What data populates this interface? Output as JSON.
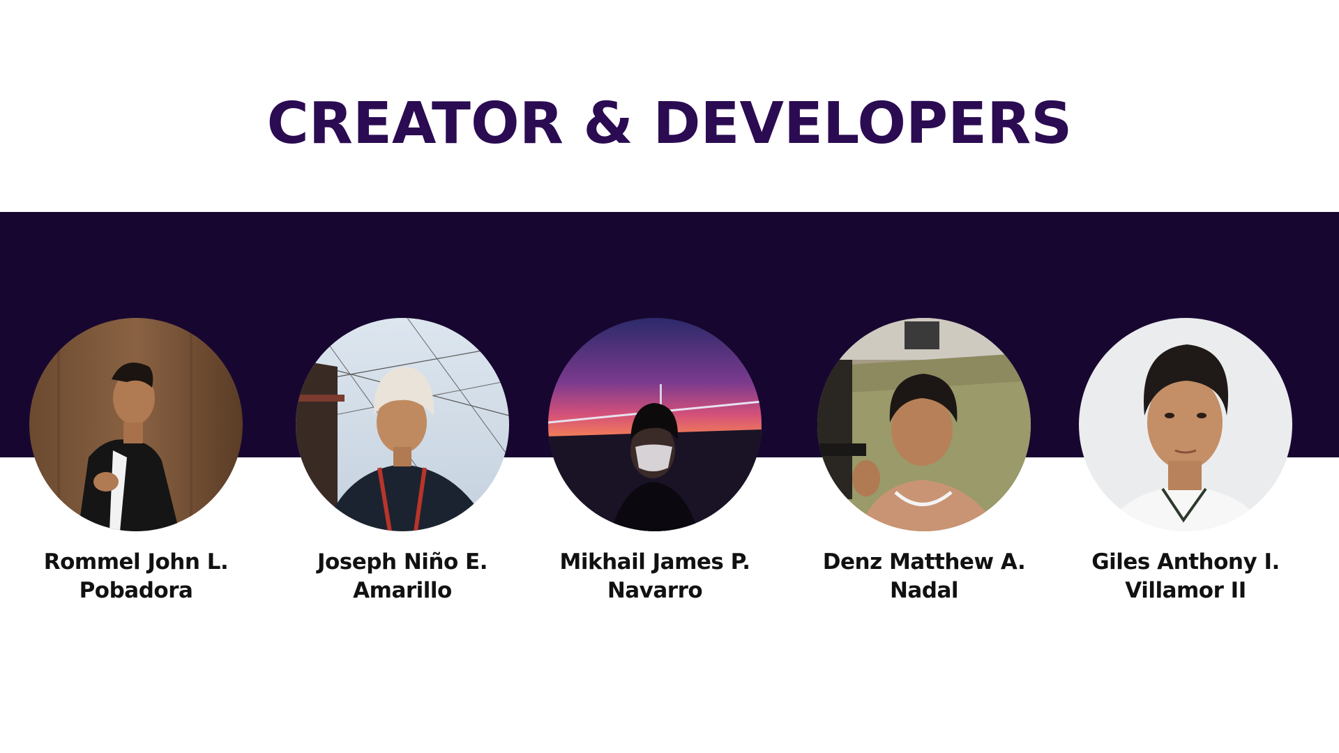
{
  "title": "CREATOR & DEVELOPERS",
  "colors": {
    "title": "#2b0b52",
    "band": "#170730",
    "name_text": "#111111"
  },
  "members": [
    {
      "name_line1": "Rommel John L.",
      "name_line2": "Pobadora",
      "photo": "portrait-suit-indoor"
    },
    {
      "name_line1": "Joseph Niño E.",
      "name_line2": "Amarillo",
      "photo": "portrait-beanie-wires"
    },
    {
      "name_line1": "Mikhail James P.",
      "name_line2": "Navarro",
      "photo": "portrait-sunset-bridge"
    },
    {
      "name_line1": "Denz Matthew A.",
      "name_line2": "Nadal",
      "photo": "portrait-outdoor-grass"
    },
    {
      "name_line1": "Giles Anthony I.",
      "name_line2": "Villamor II",
      "photo": "portrait-white-background"
    }
  ]
}
